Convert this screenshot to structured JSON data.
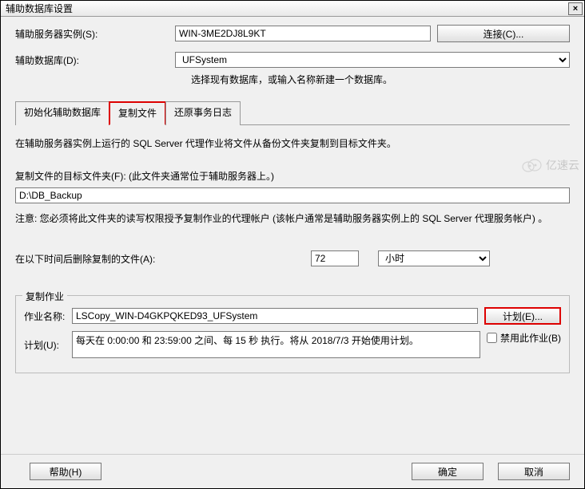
{
  "title": "辅助数据库设置",
  "close_icon": "×",
  "server": {
    "label": "辅助服务器实例(S):",
    "value": "WIN-3ME2DJ8L9KT",
    "connect_btn": "连接(C)..."
  },
  "database": {
    "label": "辅助数据库(D):",
    "selected": "UFSystem",
    "hint": "选择现有数据库，或输入名称新建一个数据库。"
  },
  "tabs": {
    "init": "初始化辅助数据库",
    "copy": "复制文件",
    "restore": "还原事务日志"
  },
  "copy_tab": {
    "desc": "在辅助服务器实例上运行的 SQL Server 代理作业将文件从备份文件夹复制到目标文件夹。",
    "dest_label": "复制文件的目标文件夹(F):  (此文件夹通常位于辅助服务器上。)",
    "dest_value": "D:\\DB_Backup",
    "note": "注意: 您必须将此文件夹的读写权限授予复制作业的代理帐户 (该帐户通常是辅助服务器实例上的 SQL Server 代理服务帐户) 。",
    "delete_label": "在以下时间后删除复制的文件(A):",
    "delete_value": "72",
    "delete_unit": "小时"
  },
  "job": {
    "group_title": "复制作业",
    "name_label": "作业名称:",
    "name_value": "LSCopy_WIN-D4GKPQKED93_UFSystem",
    "plan_btn": "计划(E)...",
    "sched_label": "计划(U):",
    "sched_value": "每天在 0:00:00 和 23:59:00 之间、每 15 秒 执行。将从 2018/7/3 开始使用计划。",
    "disable_label": "禁用此作业(B)"
  },
  "footer": {
    "help": "帮助(H)",
    "ok": "确定",
    "cancel": "取消"
  },
  "watermark": "亿速云"
}
